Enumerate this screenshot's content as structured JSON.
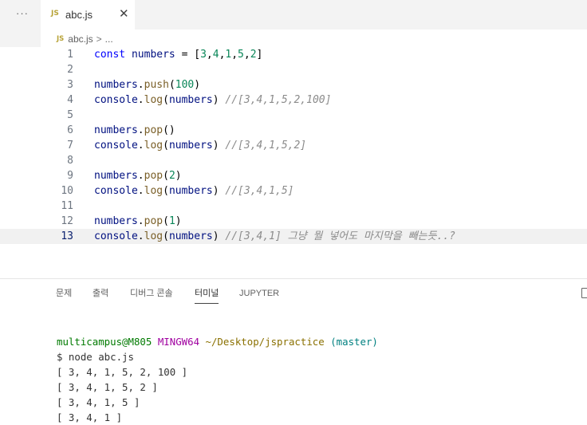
{
  "tabs": {
    "overflow": "···",
    "active": {
      "icon": "JS",
      "label": "abc.js",
      "close": "✕"
    }
  },
  "breadcrumb": {
    "icon": "JS",
    "file": "abc.js",
    "separator": ">",
    "more": "..."
  },
  "editor": {
    "current_line": 13,
    "lines": [
      {
        "n": "1",
        "tokens": [
          [
            "kw",
            "const"
          ],
          [
            "",
            " "
          ],
          [
            "var",
            "numbers"
          ],
          [
            "",
            " = ["
          ],
          [
            "num",
            "3"
          ],
          [
            "",
            ","
          ],
          [
            "num",
            "4"
          ],
          [
            "",
            ","
          ],
          [
            "num",
            "1"
          ],
          [
            "",
            ","
          ],
          [
            "num",
            "5"
          ],
          [
            "",
            ","
          ],
          [
            "num",
            "2"
          ],
          [
            "",
            "]"
          ]
        ]
      },
      {
        "n": "2",
        "tokens": []
      },
      {
        "n": "3",
        "tokens": [
          [
            "var",
            "numbers"
          ],
          [
            "",
            "."
          ],
          [
            "fn",
            "push"
          ],
          [
            "",
            "("
          ],
          [
            "num",
            "100"
          ],
          [
            "",
            ")"
          ]
        ]
      },
      {
        "n": "4",
        "tokens": [
          [
            "var",
            "console"
          ],
          [
            "",
            "."
          ],
          [
            "fn",
            "log"
          ],
          [
            "",
            "("
          ],
          [
            "var",
            "numbers"
          ],
          [
            "",
            ") "
          ],
          [
            "cmt",
            "//[3,4,1,5,2,100]"
          ]
        ]
      },
      {
        "n": "5",
        "tokens": []
      },
      {
        "n": "6",
        "tokens": [
          [
            "var",
            "numbers"
          ],
          [
            "",
            "."
          ],
          [
            "fn",
            "pop"
          ],
          [
            "",
            "()"
          ]
        ]
      },
      {
        "n": "7",
        "tokens": [
          [
            "var",
            "console"
          ],
          [
            "",
            "."
          ],
          [
            "fn",
            "log"
          ],
          [
            "",
            "("
          ],
          [
            "var",
            "numbers"
          ],
          [
            "",
            ") "
          ],
          [
            "cmt",
            "//[3,4,1,5,2]"
          ]
        ]
      },
      {
        "n": "8",
        "tokens": []
      },
      {
        "n": "9",
        "tokens": [
          [
            "var",
            "numbers"
          ],
          [
            "",
            "."
          ],
          [
            "fn",
            "pop"
          ],
          [
            "",
            "("
          ],
          [
            "num",
            "2"
          ],
          [
            "",
            ")"
          ]
        ]
      },
      {
        "n": "10",
        "tokens": [
          [
            "var",
            "console"
          ],
          [
            "",
            "."
          ],
          [
            "fn",
            "log"
          ],
          [
            "",
            "("
          ],
          [
            "var",
            "numbers"
          ],
          [
            "",
            ") "
          ],
          [
            "cmt",
            "//[3,4,1,5]"
          ]
        ]
      },
      {
        "n": "11",
        "tokens": []
      },
      {
        "n": "12",
        "tokens": [
          [
            "var",
            "numbers"
          ],
          [
            "",
            "."
          ],
          [
            "fn",
            "pop"
          ],
          [
            "",
            "("
          ],
          [
            "num",
            "1"
          ],
          [
            "",
            ")"
          ]
        ]
      },
      {
        "n": "13",
        "tokens": [
          [
            "var",
            "console"
          ],
          [
            "",
            "."
          ],
          [
            "fn",
            "log"
          ],
          [
            "",
            "("
          ],
          [
            "var",
            "numbers"
          ],
          [
            "",
            ") "
          ],
          [
            "cmt",
            "//[3,4,1] 그냥 뭘 넣어도 마지막을 빼는듯..?"
          ]
        ]
      }
    ]
  },
  "panel": {
    "tabs": [
      {
        "label": "문제",
        "active": false
      },
      {
        "label": "출력",
        "active": false
      },
      {
        "label": "디버그 콘솔",
        "active": false
      },
      {
        "label": "터미널",
        "active": true
      },
      {
        "label": "JUPYTER",
        "active": false
      }
    ],
    "terminal": {
      "prompt": {
        "user": "multicampus@M805",
        "env": "MINGW64",
        "path": "~/Desktop/jspractice",
        "branch": "(master)"
      },
      "command": "$ node abc.js",
      "output": [
        "[ 3, 4, 1, 5, 2, 100 ]",
        "[ 3, 4, 1, 5, 2 ]",
        "[ 3, 4, 1, 5 ]",
        "[ 3, 4, 1 ]"
      ]
    }
  },
  "colors": {
    "keyword": "#0000ff",
    "variable": "#001080",
    "function": "#795e26",
    "number": "#098658",
    "comment": "#8b8b8b",
    "prompt_user": "#007a00",
    "prompt_env": "#a000a0",
    "prompt_path": "#8a7000",
    "prompt_branch": "#008080"
  }
}
